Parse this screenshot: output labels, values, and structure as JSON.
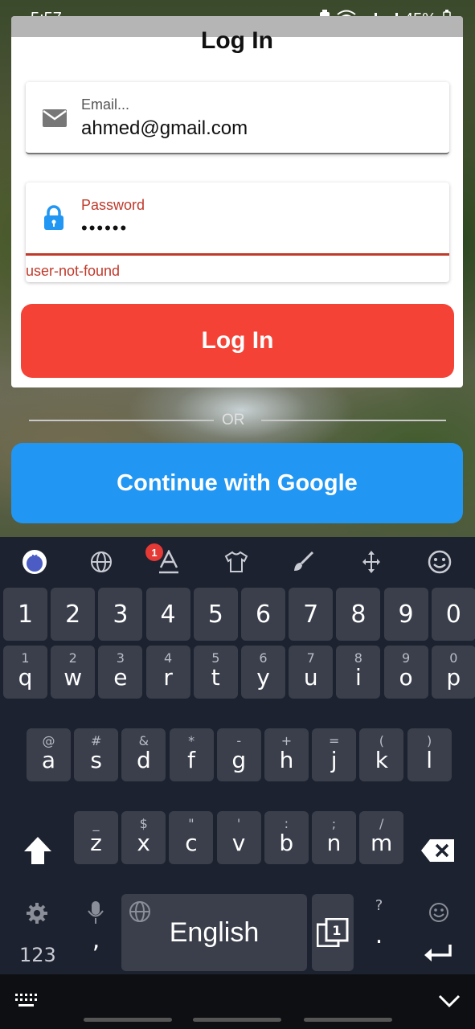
{
  "status_bar": {
    "time": "5:57",
    "battery": "45%"
  },
  "form": {
    "title": "Log In",
    "email": {
      "label": "Email...",
      "value": "ahmed@gmail.com"
    },
    "password": {
      "label": "Password",
      "value": "••••••",
      "error": "user-not-found"
    },
    "login_button": "Log In"
  },
  "divider_text": "OR",
  "google_button": "Continue with Google",
  "keyboard": {
    "toolbar_icons": [
      "kika-logo-icon",
      "globe-icon",
      "font-icon",
      "theme-shirt-icon",
      "brush-icon",
      "cursor-move-icon",
      "emoji-icon"
    ],
    "font_badge": "1",
    "number_row": [
      "1",
      "2",
      "3",
      "4",
      "5",
      "6",
      "7",
      "8",
      "9",
      "0"
    ],
    "row1": [
      {
        "key": "q",
        "sub": "1"
      },
      {
        "key": "w",
        "sub": "2"
      },
      {
        "key": "e",
        "sub": "3"
      },
      {
        "key": "r",
        "sub": "4"
      },
      {
        "key": "t",
        "sub": "5"
      },
      {
        "key": "y",
        "sub": "6"
      },
      {
        "key": "u",
        "sub": "7"
      },
      {
        "key": "i",
        "sub": "8"
      },
      {
        "key": "o",
        "sub": "9"
      },
      {
        "key": "p",
        "sub": "0"
      }
    ],
    "row2": [
      {
        "key": "a",
        "sub": "@"
      },
      {
        "key": "s",
        "sub": "#"
      },
      {
        "key": "d",
        "sub": "&"
      },
      {
        "key": "f",
        "sub": "*"
      },
      {
        "key": "g",
        "sub": "-"
      },
      {
        "key": "h",
        "sub": "+"
      },
      {
        "key": "j",
        "sub": "="
      },
      {
        "key": "k",
        "sub": "("
      },
      {
        "key": "l",
        "sub": ")"
      }
    ],
    "row3": [
      {
        "key": "z",
        "sub": "_"
      },
      {
        "key": "x",
        "sub": "$"
      },
      {
        "key": "c",
        "sub": "\""
      },
      {
        "key": "v",
        "sub": "'"
      },
      {
        "key": "b",
        "sub": ":"
      },
      {
        "key": "n",
        "sub": ";"
      },
      {
        "key": "m",
        "sub": "/"
      }
    ],
    "symbols_key": "123",
    "comma_key": ",",
    "space_label": "English",
    "period_key": ".",
    "period_sub": "?"
  },
  "colors": {
    "login_red": "#f44336",
    "google_blue": "#2196f3",
    "error_red": "#c0392b",
    "keyboard_bg": "#1d2230",
    "key_bg": "#3a3f4b"
  }
}
